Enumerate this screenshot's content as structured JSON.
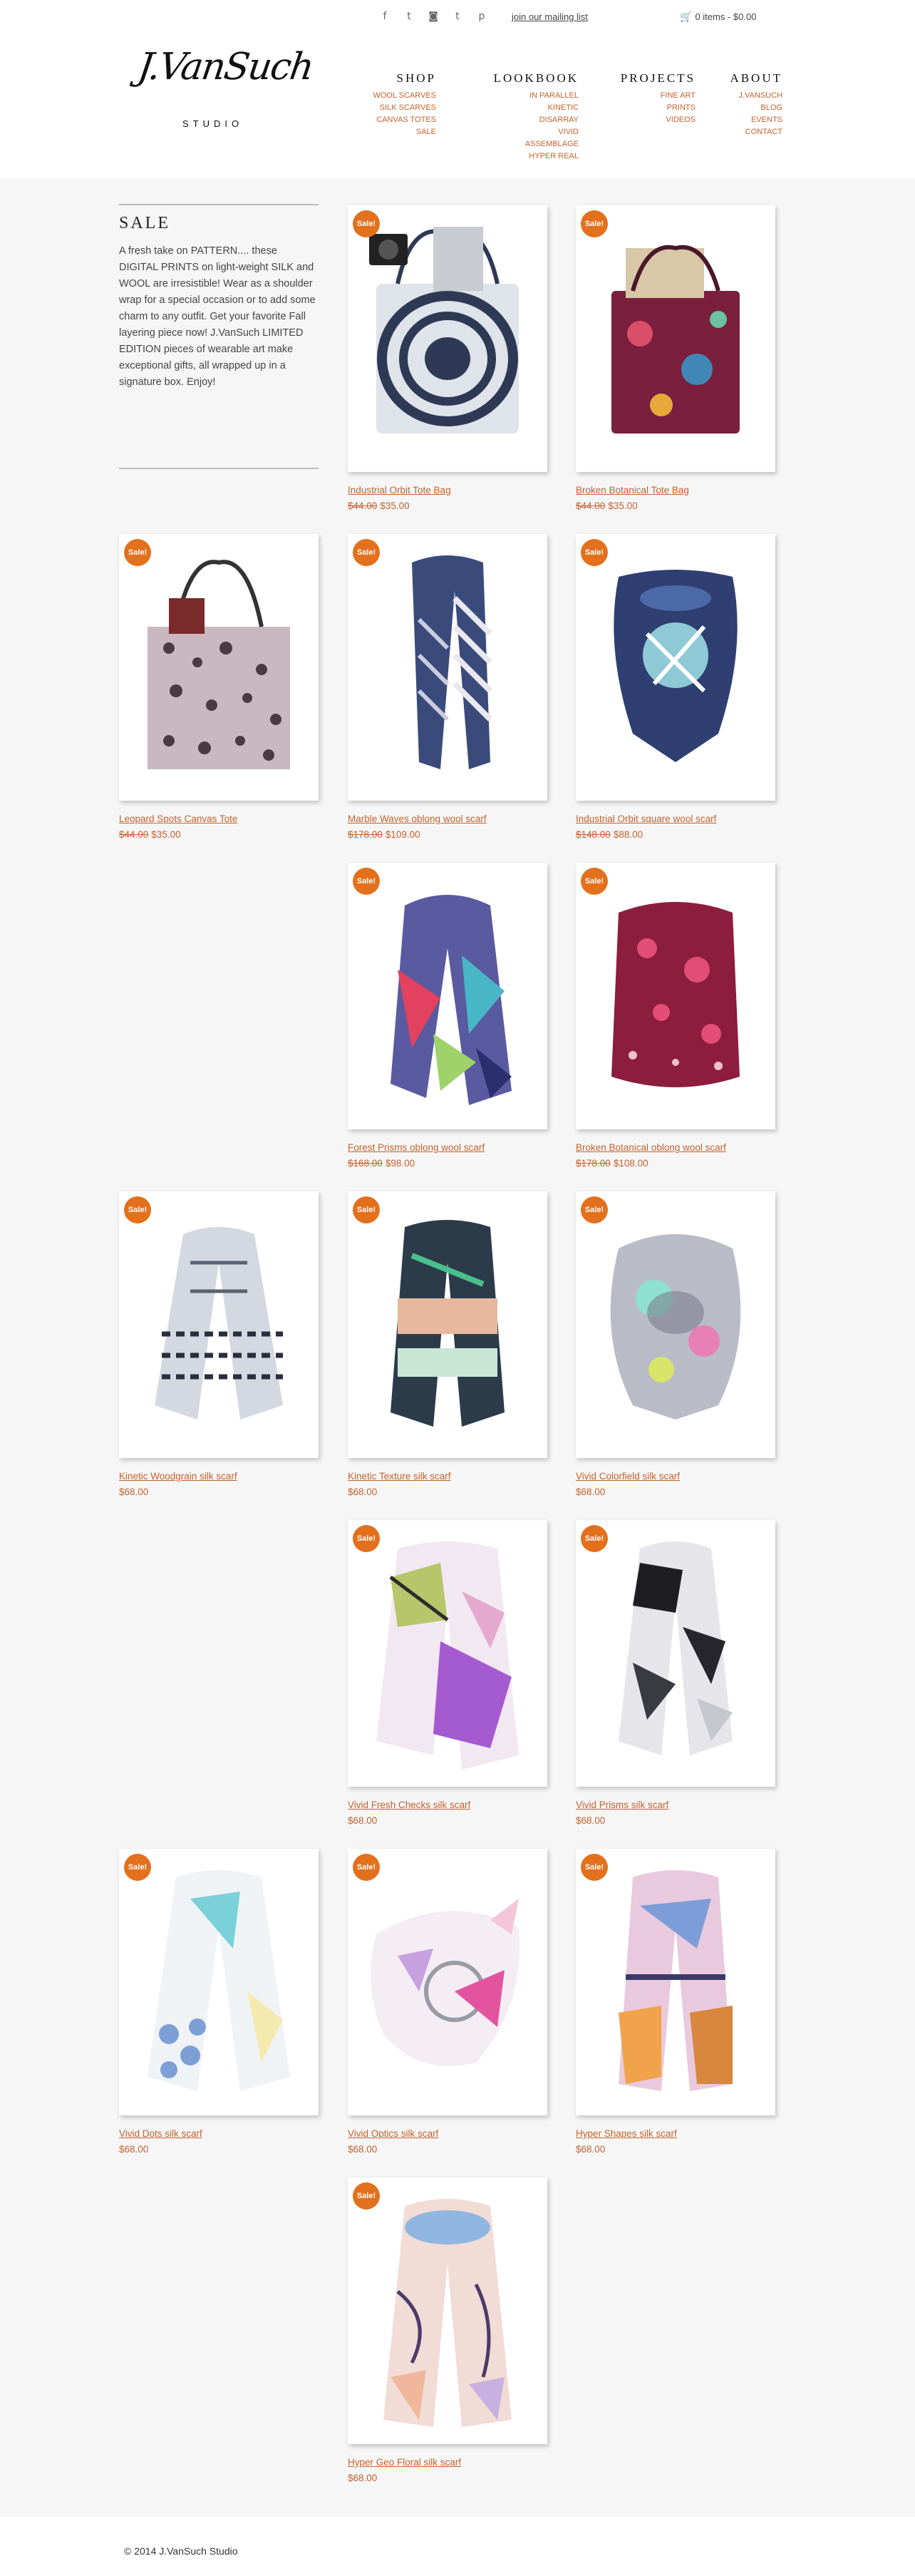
{
  "topbar": {
    "social": [
      {
        "icon": "facebook-icon",
        "glyph": "f"
      },
      {
        "icon": "twitter-icon",
        "glyph": "t"
      },
      {
        "icon": "instagram-icon",
        "glyph": "◙"
      },
      {
        "icon": "tumblr-icon",
        "glyph": "t"
      },
      {
        "icon": "pinterest-icon",
        "glyph": "p"
      }
    ],
    "mailing_label": "join our mailing list",
    "cart_label": "0 items - $0.00"
  },
  "logo": {
    "script": "J.VanSuch",
    "studio": "STUDIO"
  },
  "nav": {
    "shop": {
      "title": "SHOP",
      "items": [
        "WOOL SCARVES",
        "SILK SCARVES",
        "CANVAS TOTES",
        "SALE"
      ]
    },
    "lookbook": {
      "title": "LOOKBOOK",
      "items": [
        "IN PARALLEL",
        "KINETIC",
        "DISARRAY",
        "VIVID",
        "ASSEMBLAGE",
        "HYPER REAL"
      ]
    },
    "projects": {
      "title": "PROJECTS",
      "items": [
        "FINE ART",
        "PRINTS",
        "VIDEOS"
      ]
    },
    "about": {
      "title": "ABOUT",
      "items": [
        "J.VANSUCH",
        "BLOG",
        "EVENTS",
        "CONTACT"
      ]
    }
  },
  "sidebar": {
    "title": "SALE",
    "text": "A fresh take on PATTERN.... these DIGITAL PRINTS on light-weight SILK and WOOL are irresistible! Wear as a shoulder wrap for a special occasion or to add some charm to any outfit. Get your favorite Fall layering piece now! J.VanSuch LIMITED EDITION pieces of wearable art make exceptional gifts, all wrapped up in a signature box. Enjoy!"
  },
  "badge_label": "Sale!",
  "products": [
    {
      "name": "Industrial Orbit Tote Bag",
      "old_price": "$44.00",
      "price": "$35.00"
    },
    {
      "name": "Broken Botanical Tote Bag",
      "old_price": "$44.00",
      "price": "$35.00"
    },
    {
      "name": "Leopard Spots Canvas Tote",
      "old_price": "$44.00",
      "price": "$35.00"
    },
    {
      "name": "Marble Waves oblong wool scarf",
      "old_price": "$178.00",
      "price": "$109.00"
    },
    {
      "name": "Industrial Orbit square wool scarf",
      "old_price": "$148.00",
      "price": "$88.00"
    },
    {
      "name": "Forest Prisms oblong wool scarf",
      "old_price": "$168.00",
      "price": "$98.00"
    },
    {
      "name": "Broken Botanical oblong wool scarf",
      "old_price": "$178.00",
      "price": "$108.00"
    },
    {
      "name": "Kinetic Woodgrain silk scarf",
      "old_price": "",
      "price": "$68.00"
    },
    {
      "name": "Kinetic Texture silk scarf",
      "old_price": "",
      "price": "$68.00"
    },
    {
      "name": "Vivid Colorfield silk scarf",
      "old_price": "",
      "price": "$68.00"
    },
    {
      "name": "Vivid Fresh Checks silk scarf",
      "old_price": "",
      "price": "$68.00"
    },
    {
      "name": "Vivid Prisms silk scarf",
      "old_price": "",
      "price": "$68.00"
    },
    {
      "name": "Vivid Dots silk scarf",
      "old_price": "",
      "price": "$68.00"
    },
    {
      "name": "Vivid Optics silk scarf",
      "old_price": "",
      "price": "$68.00"
    },
    {
      "name": "Hyper Shapes silk scarf",
      "old_price": "",
      "price": "$68.00"
    },
    {
      "name": "Hyper Geo Floral silk scarf",
      "old_price": "",
      "price": "$68.00"
    }
  ],
  "footer": {
    "copyright": "© 2014 J.VanSuch Studio"
  },
  "colors": {
    "accent": "#c4622d",
    "badge": "#e3701c",
    "background": "#f6f6f6"
  }
}
